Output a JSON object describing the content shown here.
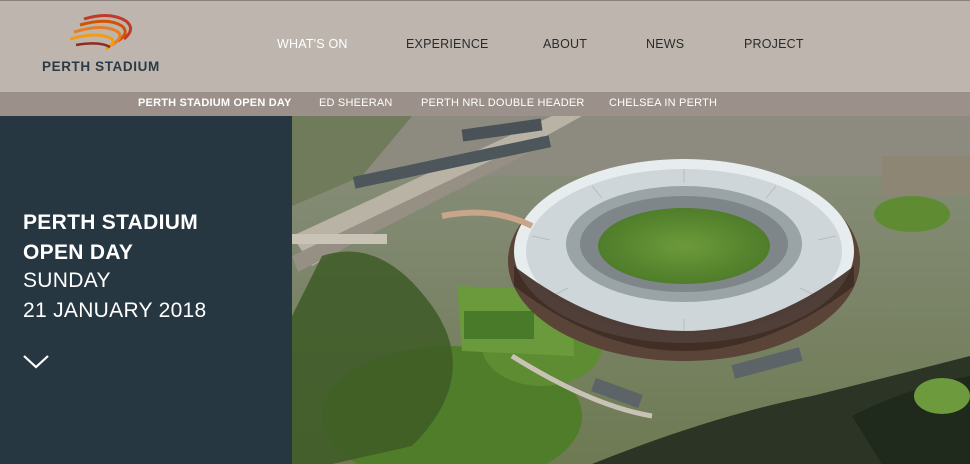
{
  "brand": {
    "name": "PERTH STADIUM",
    "logo_colors": [
      "#c0392b",
      "#d35400",
      "#e67e22",
      "#f39c12"
    ]
  },
  "main_nav": {
    "items": [
      {
        "label": "WHAT'S ON",
        "active": true
      },
      {
        "label": "EXPERIENCE",
        "active": false
      },
      {
        "label": "ABOUT",
        "active": false
      },
      {
        "label": "NEWS",
        "active": false
      },
      {
        "label": "PROJECT",
        "active": false
      }
    ]
  },
  "sub_nav": {
    "items": [
      {
        "label": "PERTH STADIUM OPEN DAY",
        "active": true
      },
      {
        "label": "ED SHEERAN",
        "active": false
      },
      {
        "label": "PERTH NRL DOUBLE HEADER",
        "active": false
      },
      {
        "label": "CHELSEA IN PERTH",
        "active": false
      }
    ]
  },
  "hero": {
    "title_line1": "PERTH STADIUM",
    "title_line2": "OPEN DAY",
    "day": "SUNDAY",
    "date": "21 JANUARY 2018",
    "scroll_icon": "chevron-down-icon",
    "image": "aerial-photo-of-stadium"
  },
  "colors": {
    "topbar": "#beb6ae",
    "subbar": "#9b918a",
    "panel": "#263741",
    "active_nav": "#ffffff"
  }
}
